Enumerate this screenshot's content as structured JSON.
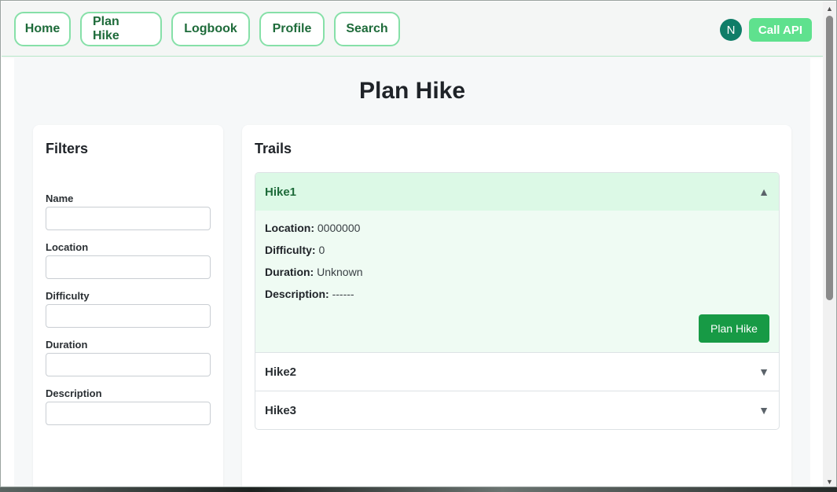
{
  "nav": {
    "items": [
      "Home",
      "Plan Hike",
      "Logbook",
      "Profile",
      "Search"
    ],
    "avatar_initial": "N",
    "call_api_label": "Call API"
  },
  "page": {
    "title": "Plan Hike"
  },
  "filters": {
    "title": "Filters",
    "fields": [
      {
        "label": "Name",
        "value": ""
      },
      {
        "label": "Location",
        "value": ""
      },
      {
        "label": "Difficulty",
        "value": ""
      },
      {
        "label": "Duration",
        "value": ""
      },
      {
        "label": "Description",
        "value": ""
      }
    ]
  },
  "trails": {
    "title": "Trails",
    "items": [
      {
        "name": "Hike1",
        "expanded": true,
        "location_label": "Location:",
        "location": "0000000",
        "difficulty_label": "Difficulty:",
        "difficulty": "0",
        "duration_label": "Duration:",
        "duration": "Unknown",
        "description_label": "Description:",
        "description": "------",
        "plan_button": "Plan Hike"
      },
      {
        "name": "Hike2",
        "expanded": false
      },
      {
        "name": "Hike3",
        "expanded": false
      }
    ]
  },
  "icons": {
    "expanded_caret": "▲",
    "collapsed_caret": "▼",
    "scroll_up": "▲",
    "scroll_down": "▼"
  },
  "colors": {
    "accent_green": "#179a45",
    "nav_border": "#86e0a8",
    "call_api_bg": "#5fe18e",
    "avatar_bg": "#0f7d68",
    "open_header_bg": "#dcf9e6"
  }
}
